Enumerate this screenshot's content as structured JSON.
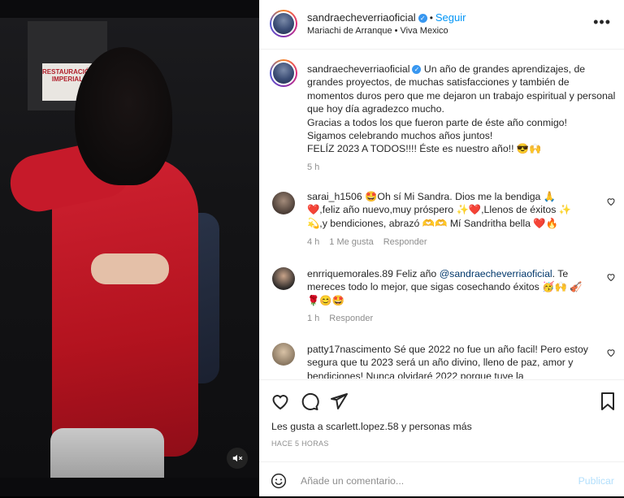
{
  "post": {
    "username": "sandraecheverriaoficial",
    "follow_label": "Seguir",
    "audio": "Mariachi de Arranque",
    "location": "Viva Mexico",
    "audio_separator": "•",
    "more_label": "•••"
  },
  "media": {
    "sign_text": "RESTAURACIÓN\nIMPERIAL",
    "mute_state": "muted"
  },
  "caption": {
    "username": "sandraecheverriaoficial",
    "text": "Un año de grandes aprendizajes, de grandes proyectos, de muchas satisfacciones y también de momentos duros pero que me dejaron un trabajo espiritual y personal que hoy día agradezco mucho.\nGracias a todos los que fueron parte de éste año conmigo!\nSigamos celebrando muchos años juntos!\nFELÍZ 2023 A TODOS!!!! Éste es nuestro año!! 😎🙌",
    "time": "5 h"
  },
  "comments": [
    {
      "username": "sarai_h1506",
      "text": "🤩Oh sí Mi Sandra. Dios me la bendiga 🙏 ❤️,feliz año nuevo,muy próspero ✨❤️,Llenos de éxitos ✨ 💫,y bendiciones, abrazó 🫶🫶 Mí Sandritha bella ❤️🔥",
      "time": "4 h",
      "likes": "1 Me gusta",
      "reply": "Responder"
    },
    {
      "username": "enrriquemorales.89",
      "text_before": "Feliz año ",
      "mention": "@sandraecheverriaoficial",
      "text_after": ". Te mereces todo lo mejor, que sigas cosechando éxitos 🥳🙌 🎻🌹😊🤩",
      "time": "1 h",
      "reply": "Responder"
    },
    {
      "username": "patty17nascimento",
      "text": "Sé que 2022 no fue un año facil! Pero estoy segura que tu 2023 será un año divino, lleno de paz, amor y bendiciones! Nunca olvidaré 2022 porque tuve la"
    }
  ],
  "actions": {
    "likes_text": "Les gusta a scarlett.lopez.58 y personas más",
    "ago": "HACE 5 HORAS",
    "comment_placeholder": "Añade un comentario...",
    "post_label": "Publicar"
  },
  "colors": {
    "link_blue": "#0095f6",
    "muted_gray": "#8e8e8e",
    "heart_red": "#ed4956"
  }
}
